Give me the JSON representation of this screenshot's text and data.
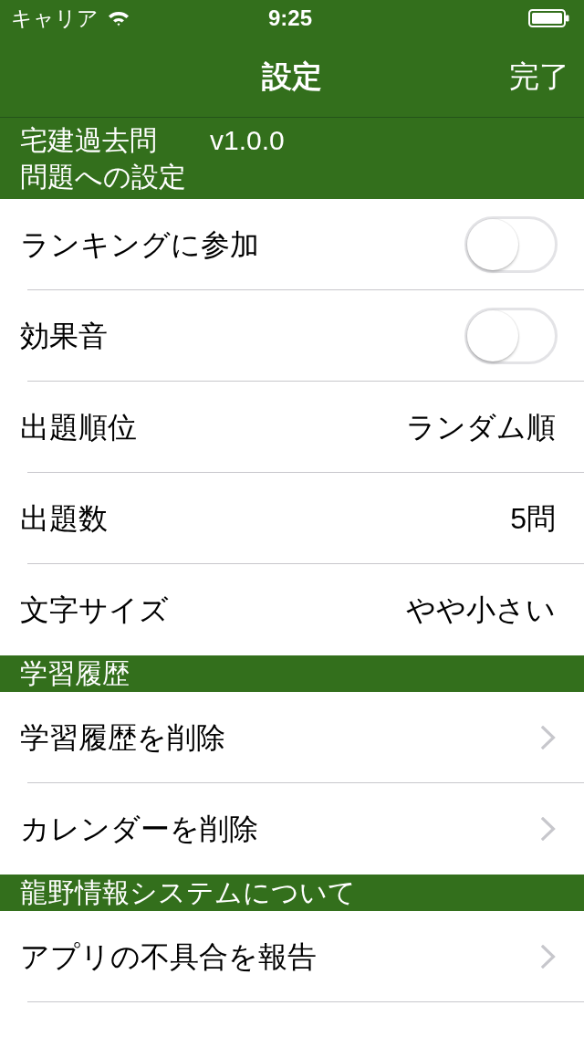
{
  "status_bar": {
    "carrier": "キャリア",
    "time": "9:25"
  },
  "nav_bar": {
    "title": "設定",
    "done_button": "完了"
  },
  "sections": [
    {
      "app_name": "宅建過去問",
      "version": "v1.0.0",
      "title": "問題への設定",
      "rows": [
        {
          "kind": "toggle",
          "label": "ランキングに参加",
          "on": false
        },
        {
          "kind": "toggle",
          "label": "効果音",
          "on": false
        },
        {
          "kind": "value",
          "label": "出題順位",
          "value": "ランダム順"
        },
        {
          "kind": "value",
          "label": "出題数",
          "value": "5問"
        },
        {
          "kind": "value",
          "label": "文字サイズ",
          "value": "やや小さい"
        }
      ]
    },
    {
      "title": "学習履歴",
      "rows": [
        {
          "kind": "link",
          "label": "学習履歴を削除"
        },
        {
          "kind": "link",
          "label": "カレンダーを削除"
        }
      ]
    },
    {
      "title": "龍野情報システムについて",
      "rows": [
        {
          "kind": "link",
          "label": "アプリの不具合を報告"
        }
      ]
    }
  ]
}
